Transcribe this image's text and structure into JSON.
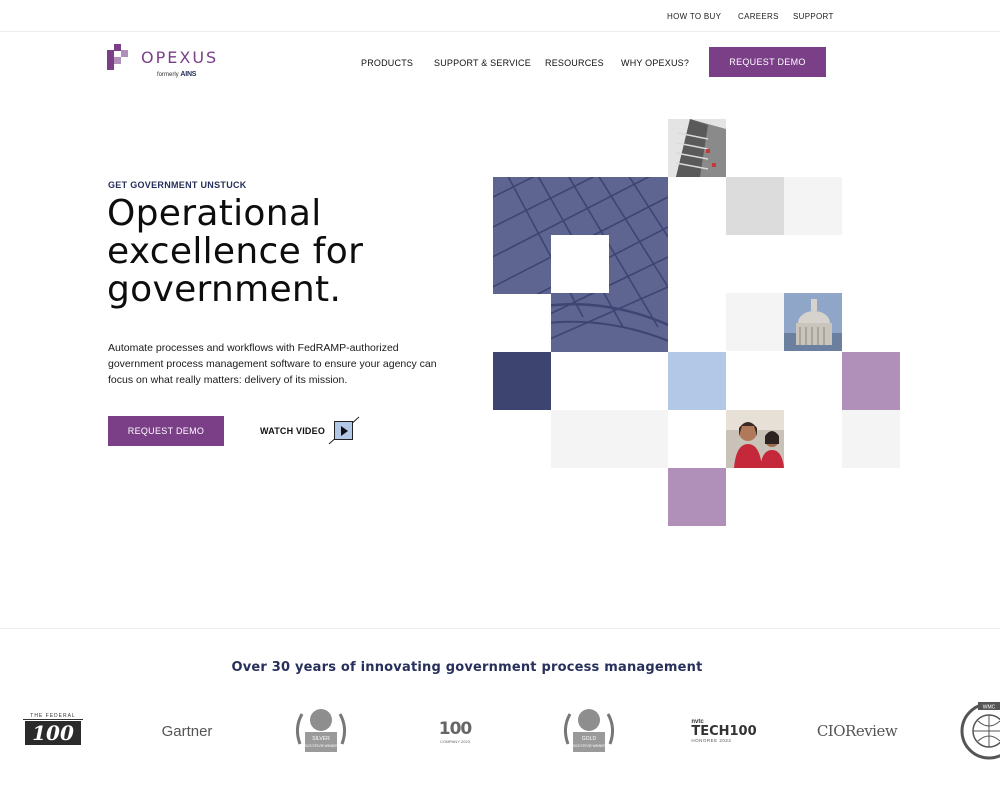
{
  "utility_nav": [
    {
      "label": "HOW TO BUY"
    },
    {
      "label": "CAREERS"
    },
    {
      "label": "SUPPORT"
    }
  ],
  "brand": {
    "name": "OPEXUS",
    "formerly": "formerly",
    "former_name": "AINS",
    "color": "#7a3f87"
  },
  "main_nav": [
    {
      "label": "PRODUCTS"
    },
    {
      "label": "SUPPORT & SERVICE"
    },
    {
      "label": "RESOURCES"
    },
    {
      "label": "WHY OPEXUS?"
    }
  ],
  "nav_cta": "REQUEST DEMO",
  "hero": {
    "eyebrow": "GET GOVERNMENT UNSTUCK",
    "headline_lines": [
      "Operational",
      "excellence for",
      "government."
    ],
    "body": "Automate processes and workflows with FedRAMP-authorized government process management software to ensure your agency can focus on what really matters: delivery of its mission.",
    "primary_cta": "REQUEST DEMO",
    "secondary_cta": "WATCH VIDEO"
  },
  "colors": {
    "navy": "#3d4470",
    "purple": "#7a3f87",
    "lavender": "#b08fb8",
    "light_blue": "#b3c7e6"
  },
  "awards": {
    "tagline": "Over 30 years of innovating government process management",
    "logos": [
      {
        "label": "THE FEDERAL",
        "mark": "100"
      },
      {
        "label": "Gartner"
      },
      {
        "label": "SILVER",
        "sub": "2023 STEVIE WINNER"
      },
      {
        "label": "100",
        "sub": "COMPANY 2023"
      },
      {
        "label": "GOLD",
        "sub": "2023 STEVIE WINNER"
      },
      {
        "label": "nvtc",
        "mark": "TECH100",
        "sub": "HONOREE 2022"
      },
      {
        "label": "CIOReview"
      },
      {
        "label": "WMC"
      }
    ]
  }
}
